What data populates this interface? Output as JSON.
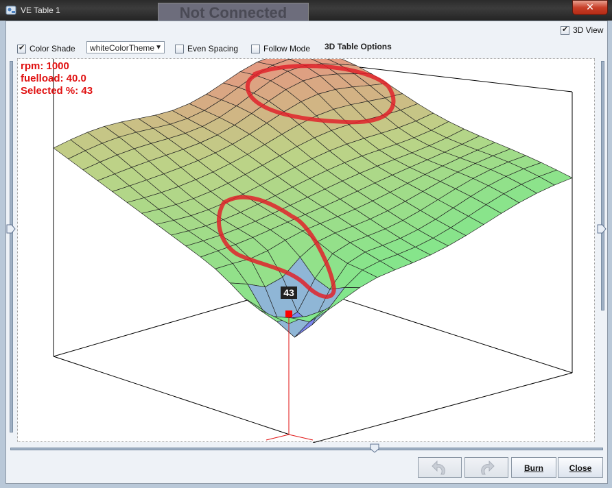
{
  "window": {
    "title": "VE Table 1",
    "connection_status": "Not Connected",
    "close_glyph": "✕"
  },
  "toolbar": {
    "view3d": {
      "label": "3D View",
      "checked": true
    },
    "color_shade": {
      "label": "Color Shade",
      "checked": true
    },
    "theme": {
      "selected": "whiteColorTheme",
      "arrow": "▼"
    },
    "even_spacing": {
      "label": "Even Spacing",
      "checked": false
    },
    "follow_mode": {
      "label": "Follow Mode",
      "checked": false
    },
    "options_label": "3D Table Options"
  },
  "readout": {
    "rpm": "rpm: 1000",
    "fuelload": "fuelload: 40.0",
    "selected": "Selected %: 43"
  },
  "cursor": {
    "value_label": "43"
  },
  "sliders": {
    "left_position": 0.5,
    "right_position": 0.5,
    "bottom_position": 0.62
  },
  "buttons": {
    "undo": "undo-icon",
    "redo": "redo-icon",
    "burn": "Burn",
    "close": "Close"
  },
  "colors": {
    "high": "#e88c80",
    "mid": "#b9d18a",
    "low": "#7de88c",
    "deep": "#7c86ee",
    "annotation": "#e0222a"
  }
}
